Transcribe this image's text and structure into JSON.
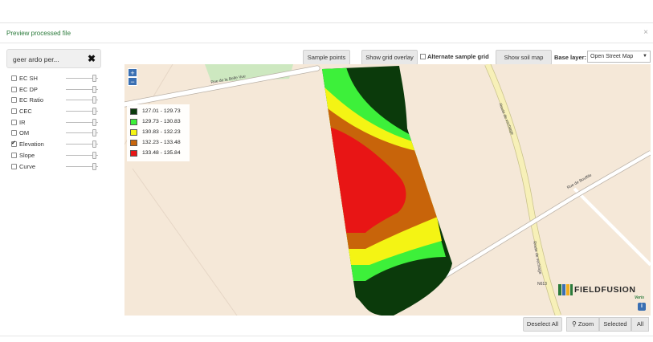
{
  "modal": {
    "title": "Preview processed file",
    "close_symbol": "×"
  },
  "field_selector": {
    "value": "geer ardo per...",
    "clear_symbol": "✖"
  },
  "layers": [
    {
      "label": "EC SH",
      "checked": false
    },
    {
      "label": "EC DP",
      "checked": false
    },
    {
      "label": "EC Ratio",
      "checked": false
    },
    {
      "label": "CEC",
      "checked": false
    },
    {
      "label": "IR",
      "checked": false
    },
    {
      "label": "OM",
      "checked": false
    },
    {
      "label": "Elevation",
      "checked": true
    },
    {
      "label": "Slope",
      "checked": false
    },
    {
      "label": "Curve",
      "checked": false
    }
  ],
  "toolbar": {
    "sample_points": "Sample points",
    "show_grid_overlay": "Show grid overlay",
    "alternate_sample_grid": "Alternate sample grid",
    "show_soil_map": "Show soil map",
    "base_layer_label": "Base layer:",
    "base_layer_value": "Open Street Map"
  },
  "map": {
    "zoom_in": "+",
    "zoom_out": "−",
    "legend": [
      {
        "label": "127.01 - 129.73",
        "color": "#0b3a0b"
      },
      {
        "label": "129.73 - 130.83",
        "color": "#3df03a"
      },
      {
        "label": "130.83 - 132.23",
        "color": "#f4f414"
      },
      {
        "label": "132.23 - 133.48",
        "color": "#c8640a"
      },
      {
        "label": "133.48 - 135.84",
        "color": "#e81515"
      }
    ],
    "roads": {
      "belle_vue": "Rue de la Belle Vue",
      "vechiage_1": "Route de vechiage",
      "bouffile": "Rue de Bouffile",
      "vechiage_2": "Route de vechiage",
      "route_number": "N613"
    },
    "logo": {
      "brand": "FIELDFUSION",
      "sub": "Veris"
    },
    "info": "i"
  },
  "bottom": {
    "deselect_all": "Deselect All",
    "zoom": "Zoom",
    "selected": "Selected",
    "all": "All"
  },
  "colors": {
    "map_background": "#f5e8d8",
    "accent_blue": "#3a6fb2",
    "title_green": "#2a7a3a"
  }
}
